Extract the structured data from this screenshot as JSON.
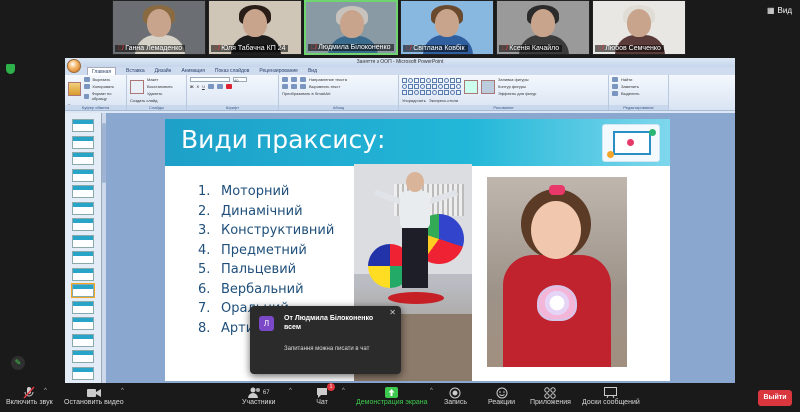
{
  "gallery": {
    "view_label": "Вид",
    "participants": [
      {
        "name": "Ганна Лемаденко",
        "hair": "#8a6a40",
        "shirt": "#d7d2c8",
        "bg": "#6b6e72",
        "muted": true
      },
      {
        "name": "Юля Табачна КП 24",
        "hair": "#2a1d17",
        "shirt": "#1c1c1c",
        "bg": "#cfc6b8",
        "muted": true
      },
      {
        "name": "Людмила Білоконенко",
        "hair": "#c7c2bb",
        "shirt": "#3a6a8c",
        "bg": "#8a9aa5",
        "muted": true,
        "active": true
      },
      {
        "name": "Світлана Ковбік",
        "hair": "#6a4a2e",
        "shirt": "#2f5f9f",
        "bg": "#88b7e0",
        "muted": true
      },
      {
        "name": "Ксенія Качайло",
        "hair": "#2b2b2b",
        "shirt": "#3b3b3b",
        "bg": "#9a9a9a",
        "muted": true
      },
      {
        "name": "Любов Семченко",
        "hair": "#e0dcd6",
        "shirt": "#5b3a3a",
        "bg": "#e9e7e4",
        "muted": true
      }
    ]
  },
  "ppt": {
    "window_title": "Заняття з ООП - Microsoft PowerPoint",
    "tabs": [
      "Главная",
      "Вставка",
      "Дизайн",
      "Анимация",
      "Показ слайдов",
      "Рецензирование",
      "Вид"
    ],
    "ribbon": {
      "clipboard": {
        "paste": "Вставить",
        "cut": "Вырезать",
        "copy": "Копировать",
        "format": "Формат по образцу",
        "label": "Буфер обмена"
      },
      "slides": {
        "new": "Создать слайд",
        "layout": "Макет",
        "reset": "Восстановить",
        "delete": "Удалить",
        "label": "Слайды"
      },
      "font": {
        "label": "Шрифт",
        "size": "40"
      },
      "paragraph": {
        "direction": "Направление текста",
        "align": "Выровнять текст",
        "smartart": "Преобразовать в SmartArt",
        "label": "Абзац"
      },
      "drawing": {
        "arrange": "Упорядочить",
        "styles": "Экспресс-стили",
        "fill": "Заливка фигуры",
        "outline": "Контур фигуры",
        "effects": "Эффекты для фигур",
        "label": "Рисование"
      },
      "editing": {
        "find": "Найти",
        "replace": "Заменить",
        "select": "Выделить",
        "label": "Редактирование"
      }
    },
    "thumb_count": 16
  },
  "slide": {
    "title": "Види праксису:",
    "items": [
      "Моторний",
      "Динамічний",
      "Конструктивний",
      "Предметний",
      "Пальцевий",
      "Вербальний",
      "Оральний",
      "Артикуляційний"
    ]
  },
  "chat": {
    "avatar": "Л",
    "from": "От Людмила Білоконенко всем",
    "message": "Запитання можна писати в чат",
    "close": "✕"
  },
  "toolbar": {
    "unmute": "Включить звук",
    "video": "Остановить видео",
    "participants": "Участники",
    "participant_count": "67",
    "chat": "Чат",
    "chat_badge": "1",
    "share": "Демонстрация экрана",
    "record": "Запись",
    "reactions": "Реакции",
    "apps": "Приложения",
    "whiteboards": "Доски сообщений",
    "leave": "Выйти"
  },
  "colors": {
    "share_green": "#3cc94e",
    "leave_red": "#d9363e",
    "slide_header": "#1ea0c8"
  }
}
